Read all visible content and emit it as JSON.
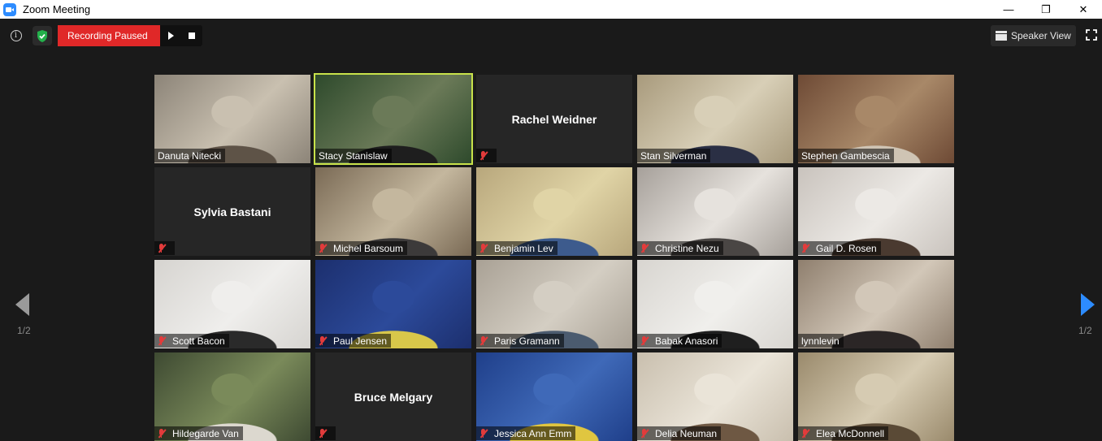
{
  "window": {
    "title": "Zoom Meeting",
    "controls": {
      "minimize": "—",
      "restore": "❐",
      "close": "✕"
    }
  },
  "toolbar": {
    "recording_label": "Recording Paused",
    "speaker_view_label": "Speaker View"
  },
  "paging": {
    "left_label": "1/2",
    "right_label": "1/2"
  },
  "participants": [
    {
      "name": "Danuta Nitecki",
      "muted": false,
      "video": true,
      "active": false,
      "colors": [
        "#8c8478",
        "#c9c0b0",
        "#5e5347"
      ]
    },
    {
      "name": "Stacy Stanislaw",
      "muted": false,
      "video": true,
      "active": true,
      "colors": [
        "#2e4a2c",
        "#6b7a58",
        "#1e1e1e"
      ]
    },
    {
      "name": "Rachel Weidner",
      "muted": true,
      "video": false,
      "active": false,
      "colors": []
    },
    {
      "name": "Stan Silverman",
      "muted": false,
      "video": true,
      "active": false,
      "colors": [
        "#a89a7c",
        "#d8cfb7",
        "#2a2f44"
      ]
    },
    {
      "name": "Stephen Gambescia",
      "muted": false,
      "video": true,
      "active": false,
      "colors": [
        "#6e4a35",
        "#a88868",
        "#cfc4b4"
      ]
    },
    {
      "name": "Sylvia Bastani",
      "muted": true,
      "video": false,
      "active": false,
      "colors": []
    },
    {
      "name": "Michel Barsoum",
      "muted": true,
      "video": true,
      "active": false,
      "colors": [
        "#7a6a55",
        "#c4b79e",
        "#3c3a3a"
      ]
    },
    {
      "name": "Benjamin Lev",
      "muted": true,
      "video": true,
      "active": false,
      "colors": [
        "#b8a77c",
        "#e0d4a6",
        "#3d5b8d"
      ]
    },
    {
      "name": "Christine Nezu",
      "muted": true,
      "video": true,
      "active": false,
      "colors": [
        "#a6a09a",
        "#e6e2dd",
        "#4a4644"
      ]
    },
    {
      "name": "Gail D. Rosen",
      "muted": true,
      "video": true,
      "active": false,
      "colors": [
        "#c9c3bd",
        "#ece9e5",
        "#4a3a30"
      ]
    },
    {
      "name": "Scott Bacon",
      "muted": true,
      "video": true,
      "active": false,
      "colors": [
        "#d6d4d0",
        "#efeeec",
        "#2a2a2a"
      ]
    },
    {
      "name": "Paul Jensen",
      "muted": true,
      "video": true,
      "active": false,
      "colors": [
        "#1c2f6e",
        "#2c4a9a",
        "#d8c74a"
      ]
    },
    {
      "name": "Paris Gramann",
      "muted": true,
      "video": true,
      "active": false,
      "colors": [
        "#a9a195",
        "#d4cec3",
        "#4b5b6f"
      ]
    },
    {
      "name": "Babak Anasori",
      "muted": true,
      "video": true,
      "active": false,
      "colors": [
        "#d8d5d0",
        "#f0efec",
        "#1f1f1f"
      ]
    },
    {
      "name": "lynnlevin",
      "muted": false,
      "video": true,
      "active": false,
      "colors": [
        "#8f7f6e",
        "#d2c7b8",
        "#2b2626"
      ]
    },
    {
      "name": "Hildegarde Van",
      "muted": true,
      "video": true,
      "active": false,
      "colors": [
        "#3e4a32",
        "#7a8a5a",
        "#dcd8cf"
      ]
    },
    {
      "name": "Bruce Melgary",
      "muted": true,
      "video": false,
      "active": false,
      "colors": []
    },
    {
      "name": "Jessica Ann Emm",
      "muted": true,
      "video": true,
      "active": false,
      "colors": [
        "#1f3f8a",
        "#3f69b8",
        "#e0c640"
      ]
    },
    {
      "name": "Delia Neuman",
      "muted": true,
      "video": true,
      "active": false,
      "colors": [
        "#c9bfae",
        "#eae4d8",
        "#6e5843"
      ]
    },
    {
      "name": "Elea McDonnell",
      "muted": true,
      "video": true,
      "active": false,
      "colors": [
        "#9a8a6c",
        "#d6cbb2",
        "#5a4a36"
      ]
    }
  ]
}
